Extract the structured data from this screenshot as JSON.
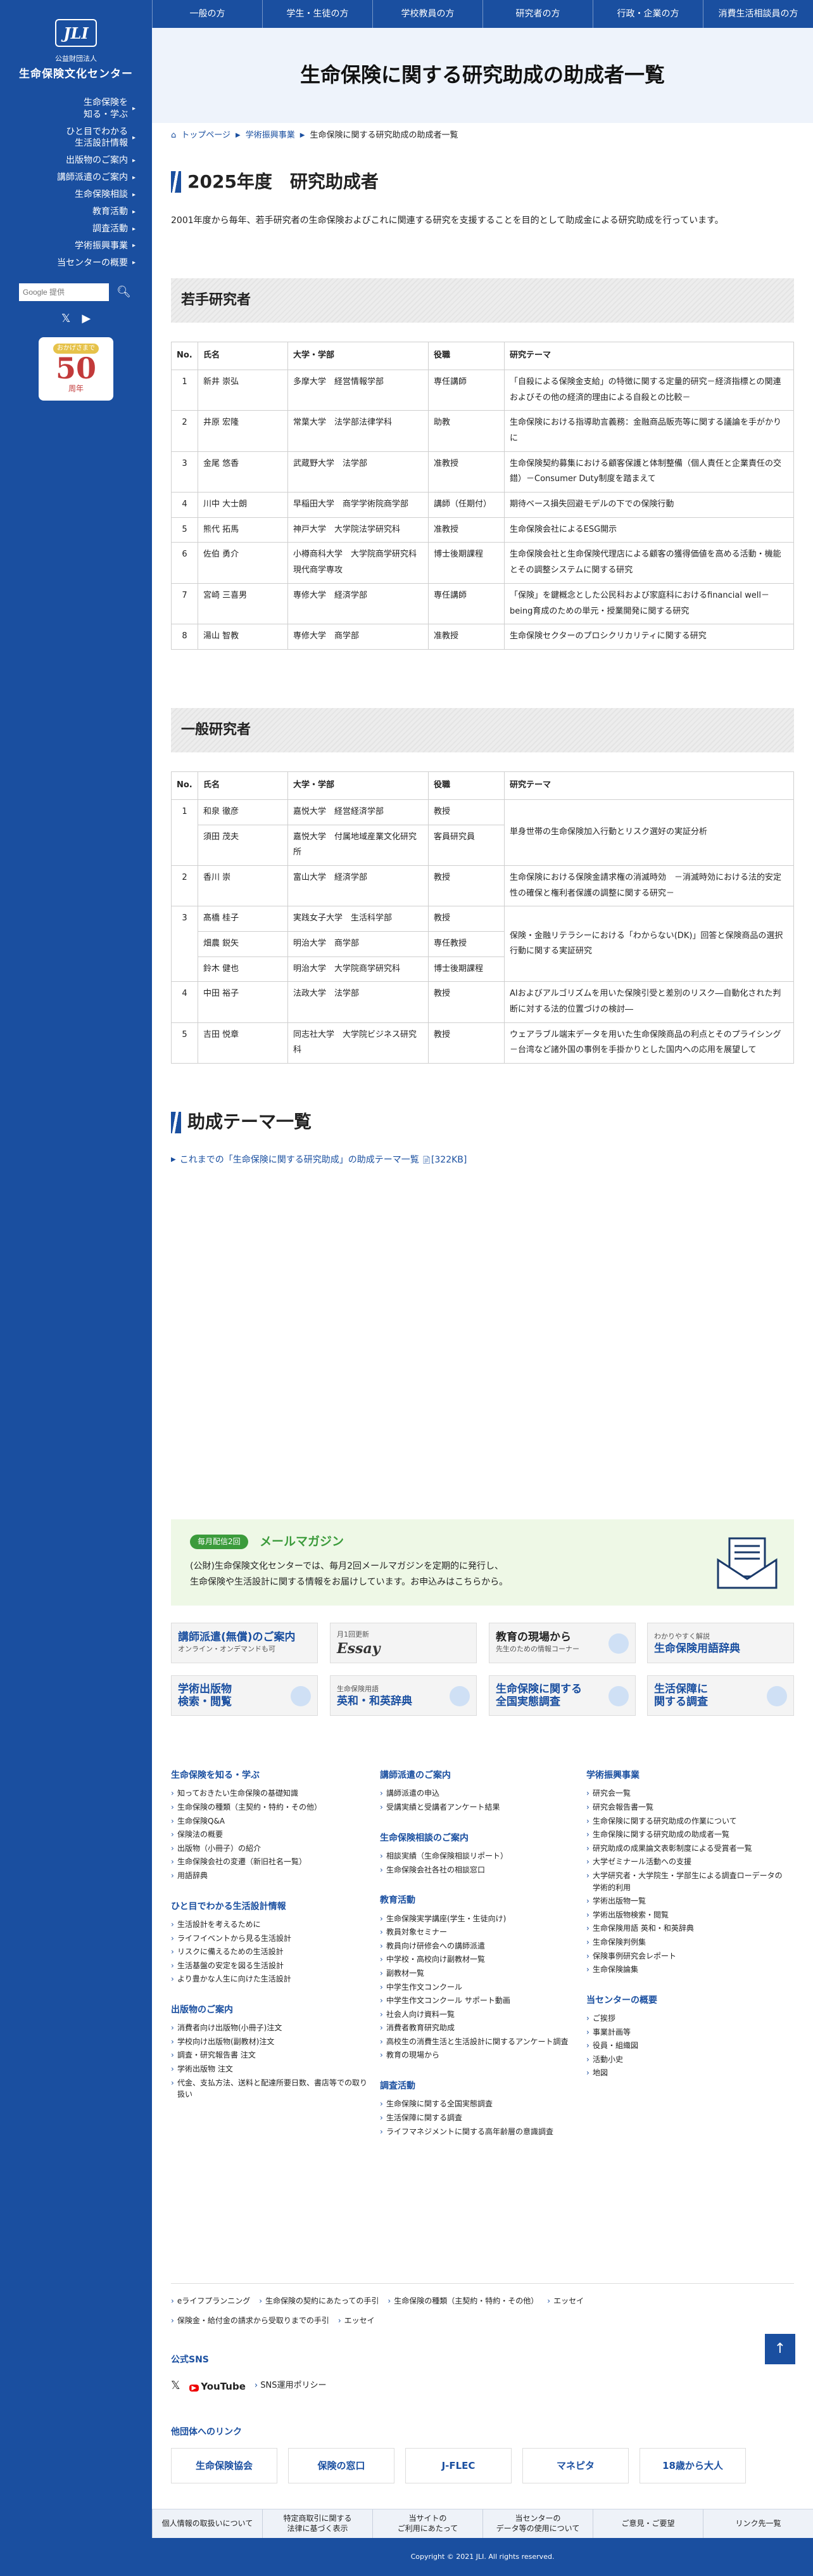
{
  "org": {
    "logo": "JLI",
    "sub": "公益財団法人",
    "name": "生命保険文化センター"
  },
  "sidebar": {
    "items": [
      {
        "label": "生命保険を\n知る・学ぶ"
      },
      {
        "label": "ひと目でわかる\n生活設計情報"
      },
      {
        "label": "出版物のご案内"
      },
      {
        "label": "講師派遣のご案内"
      },
      {
        "label": "生命保険相談"
      },
      {
        "label": "教育活動"
      },
      {
        "label": "調査活動"
      },
      {
        "label": "学術振興事業"
      },
      {
        "label": "当センターの概要"
      }
    ],
    "search_placeholder": "Google 提供",
    "badge_top": "おかげさまで",
    "badge_num": "50",
    "badge_unit": "周年"
  },
  "topnav": [
    "一般の方",
    "学生・生徒の方",
    "学校教員の方",
    "研究者の方",
    "行政・企業の方",
    "消費生活相談員の方"
  ],
  "page_title": "生命保険に関する研究助成の助成者一覧",
  "breadcrumb": [
    "トップページ",
    "学術振興事業",
    "生命保険に関する研究助成の助成者一覧"
  ],
  "year_heading": "2025年度　研究助成者",
  "intro": "2001年度から毎年、若手研究者の生命保険およびこれに関連する研究を支援することを目的として助成金による研究助成を行っています。",
  "table_headers": [
    "No.",
    "氏名",
    "大学・学部",
    "役職",
    "研究テーマ"
  ],
  "young": {
    "heading": "若手研究者",
    "rows": [
      {
        "no": "1",
        "name": "新井 崇弘",
        "univ": "多摩大学　経営情報学部",
        "pos": "専任講師",
        "theme": "「自殺による保険金支給」の特徴に関する定量的研究－経済指標との関連およびその他の経済的理由による自殺との比較－"
      },
      {
        "no": "2",
        "name": "井原 宏隆",
        "univ": "常葉大学　法学部法律学科",
        "pos": "助教",
        "theme": "生命保険における指導助言義務：金融商品販売等に関する議論を手がかりに"
      },
      {
        "no": "3",
        "name": "金尾 悠香",
        "univ": "武蔵野大学　法学部",
        "pos": "准教授",
        "theme": "生命保険契約募集における顧客保護と体制整備（個人責任と企業責任の交錯）－Consumer Duty制度を踏まえて"
      },
      {
        "no": "4",
        "name": "川中 大士朗",
        "univ": "早稲田大学　商学学術院商学部",
        "pos": "講師（任期付）",
        "theme": "期待ベース損失回避モデルの下での保険行動"
      },
      {
        "no": "5",
        "name": "熊代 拓馬",
        "univ": "神戸大学　大学院法学研究科",
        "pos": "准教授",
        "theme": "生命保険会社によるESG開示"
      },
      {
        "no": "6",
        "name": "佐伯 勇介",
        "univ": "小樽商科大学　大学院商学研究科　現代商学専攻",
        "pos": "博士後期課程",
        "theme": "生命保険会社と生命保険代理店による顧客の獲得価値を高める活動・機能とその調整システムに関する研究"
      },
      {
        "no": "7",
        "name": "宮崎 三喜男",
        "univ": "専修大学　経済学部",
        "pos": "専任講師",
        "theme": "「保険」を鍵概念とした公民科および家庭科におけるfinancial well－being育成のための単元・授業開発に関する研究"
      },
      {
        "no": "8",
        "name": "湯山 智教",
        "univ": "専修大学　商学部",
        "pos": "准教授",
        "theme": "生命保険セクターのプロシクリカリティに関する研究"
      }
    ]
  },
  "general": {
    "heading": "一般研究者",
    "rows": [
      {
        "no": "1",
        "members": [
          {
            "name": "和泉 徹彦",
            "univ": "嘉悦大学　経営経済学部",
            "pos": "教授"
          },
          {
            "name": "須田 茂夫",
            "univ": "嘉悦大学　付属地域産業文化研究所",
            "pos": "客員研究員"
          }
        ],
        "theme": "単身世帯の生命保険加入行動とリスク選好の実証分析"
      },
      {
        "no": "2",
        "members": [
          {
            "name": "香川 崇",
            "univ": "富山大学　経済学部",
            "pos": "教授"
          }
        ],
        "theme": "生命保険における保険金請求権の消滅時効　－消滅時効における法的安定性の確保と権利者保護の調整に関する研究－"
      },
      {
        "no": "3",
        "members": [
          {
            "name": "髙橋 桂子",
            "univ": "実践女子大学　生活科学部",
            "pos": "教授"
          },
          {
            "name": "畑農 鋭矢",
            "univ": "明治大学　商学部",
            "pos": "専任教授"
          },
          {
            "name": "鈴木 健也",
            "univ": "明治大学　大学院商学研究科",
            "pos": "博士後期課程"
          }
        ],
        "theme": "保険・金融リテラシーにおける「わからない(DK)」回答と保険商品の選択行動に関する実証研究"
      },
      {
        "no": "4",
        "members": [
          {
            "name": "中田 裕子",
            "univ": "法政大学　法学部",
            "pos": "教授"
          }
        ],
        "theme": "AIおよびアルゴリズムを用いた保険引受と差別のリスク―自動化された判断に対する法的位置づけの検討―"
      },
      {
        "no": "5",
        "members": [
          {
            "name": "吉田 悦章",
            "univ": "同志社大学　大学院ビジネス研究科",
            "pos": "教授"
          }
        ],
        "theme": "ウェアラブル端末データを用いた生命保険商品の利点とそのプライシング\n－台湾など諸外国の事例を手掛かりとした国内への応用を展望して"
      }
    ]
  },
  "themes": {
    "heading": "助成テーマ一覧",
    "link": "これまでの「生命保険に関する研究助成」の助成テーマ一覧",
    "size": "[322KB]"
  },
  "mailmag": {
    "tag": "毎月配信2回",
    "title": "メールマガジン",
    "desc": "(公財)生命保険文化センターでは、毎月2回メールマガジンを定期的に発行し、\n生命保険や生活設計に関する情報をお届けしています。お申込みはこちらから。"
  },
  "banners": [
    {
      "l1": "講師派遣(無償)のご案内",
      "l2": "オンライン・オンデマンドも可"
    },
    {
      "l1": "Essay",
      "l2": "月1回更新"
    },
    {
      "l1": "教育の現場から",
      "l2": "先生のための情報コーナー"
    },
    {
      "l1": "生命保険用語辞典",
      "l2": "わかりやすく解説"
    },
    {
      "l1": "学術出版物\n検索・閲覧",
      "l2": ""
    },
    {
      "l1": "英和・和英辞典",
      "l2": "生命保険用語"
    },
    {
      "l1": "生命保険に関する\n全国実態調査",
      "l2": ""
    },
    {
      "l1": "生活保障に\n関する調査",
      "l2": ""
    }
  ],
  "footer": {
    "col1": [
      {
        "h": "生命保険を知る・学ぶ",
        "items": [
          "知っておきたい生命保険の基礎知識",
          "生命保険の種類（主契約・特約・その他）",
          "生命保険Q&A",
          "保険法の概要",
          "出版物（小冊子）の紹介",
          "生命保険会社の変遷（新旧社名一覧）",
          "用語辞典"
        ]
      },
      {
        "h": "ひと目でわかる生活設計情報",
        "items": [
          "生活設計を考えるために",
          "ライフイベントから見る生活設計",
          "リスクに備えるための生活設計",
          "生活基盤の安定を図る生活設計",
          "より豊かな人生に向けた生活設計"
        ]
      },
      {
        "h": "出版物のご案内",
        "items": [
          "消費者向け出版物(小冊子)注文",
          "学校向け出版物(副教材)注文",
          "調査・研究報告書 注文",
          "学術出版物 注文",
          "代金、支払方法、送料と配達所要日数、書店等での取り扱い"
        ]
      }
    ],
    "col2": [
      {
        "h": "講師派遣のご案内",
        "items": [
          "講師派遣の申込",
          "受講実績と受講者アンケート結果"
        ]
      },
      {
        "h": "生命保険相談のご案内",
        "items": [
          "相談実績（生命保険相談リポート）",
          "生命保険会社各社の相談窓口"
        ]
      },
      {
        "h": "教育活動",
        "items": [
          "生命保険実学講座(学生・生徒向け)",
          "教員対象セミナー",
          "教員向け研修会への講師派遣",
          "中学校・高校向け副教材一覧",
          "副教材一覧",
          "中学生作文コンクール",
          "中学生作文コンクール サポート動画",
          "社会人向け資料一覧",
          "消費者教育研究助成",
          "高校生の消費生活と生活設計に関するアンケート調査",
          "教育の現場から"
        ]
      },
      {
        "h": "調査活動",
        "items": [
          "生命保険に関する全国実態調査",
          "生活保障に関する調査",
          "ライフマネジメントに関する高年齢層の意識調査"
        ]
      }
    ],
    "col3": [
      {
        "h": "学術振興事業",
        "items": [
          "研究会一覧",
          "研究会報告書一覧",
          "生命保険に関する研究助成の作業について",
          "生命保険に関する研究助成の助成者一覧",
          "研究助成の成果論文表彰制度による受賞者一覧",
          "大学ゼミナール活動への支援",
          "大学研究者・大学院生・学部生による調査ローデータの学術的利用",
          "学術出版物一覧",
          "学術出版物検索・閲覧",
          "生命保険用語 英和・和英辞典",
          "生命保険判例集",
          "保険事例研究会レポート",
          "生命保険論集"
        ]
      },
      {
        "h": "当センターの概要",
        "items": [
          "ご挨拶",
          "事業計画等",
          "役員・組織図",
          "活動小史",
          "地図"
        ]
      }
    ]
  },
  "extra_links": {
    "row1": [
      "eライフプランニング",
      "生命保険の契約にあたっての手引",
      "生命保険の種類（主契約・特約・その他）",
      "エッセイ"
    ],
    "row2": [
      "保険金・給付金の請求から受取りまでの手引",
      "エッセイ"
    ]
  },
  "sns": {
    "heading": "公式SNS",
    "youtube": "YouTube",
    "policy": "SNS運用ポリシー"
  },
  "others": {
    "heading": "他団体へのリンク",
    "items": [
      "生命保険協会",
      "保険の窓口",
      "J-FLEC",
      "マネピタ",
      "18歳から大人"
    ]
  },
  "bottom_links": [
    "個人情報の取扱いについて",
    "特定商取引に関する\n法律に基づく表示",
    "当サイトの\nご利用にあたって",
    "当センターの\nデータ等の使用について",
    "ご意見・ご要望",
    "リンク先一覧"
  ],
  "copyright": "Copyright © 2021 JLI. All rights reserved."
}
